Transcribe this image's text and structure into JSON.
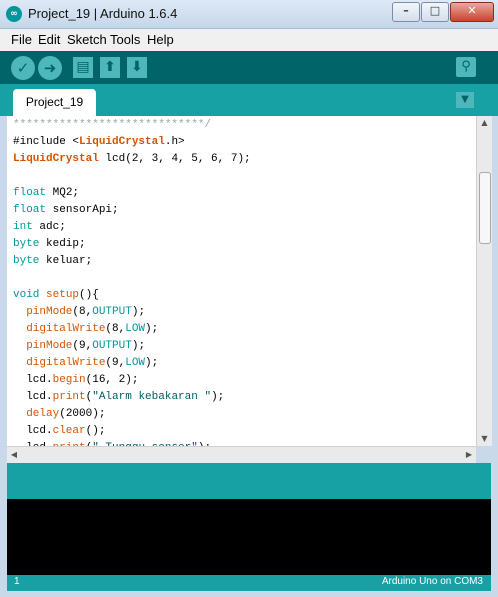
{
  "window": {
    "title": "Project_19 | Arduino 1.6.4",
    "app_icon_glyph": "∞",
    "minimize_glyph": "–",
    "maximize_glyph": "□",
    "close_glyph": "✕"
  },
  "menu": {
    "file": "File",
    "edit": "Edit",
    "sketch": "Sketch",
    "tools": "Tools",
    "help": "Help"
  },
  "toolbar": {
    "verify_icon": "check-icon",
    "upload_icon": "arrow-right-icon",
    "new_icon": "document-icon",
    "open_icon": "arrow-up-icon",
    "save_icon": "arrow-down-icon",
    "serial_monitor_icon": "magnifier-icon",
    "verify_glyph": "✓",
    "upload_glyph": "➜",
    "new_glyph": "▤",
    "open_glyph": "⬆",
    "save_glyph": "⬇",
    "serial_glyph": "⚲"
  },
  "tabs": {
    "active": "Project_19",
    "menu_glyph": "▼"
  },
  "editor": {
    "lines": [
      {
        "parts": [
          {
            "t": "*****************************/",
            "c": "comment"
          }
        ]
      },
      {
        "parts": [
          {
            "t": "#include <",
            "c": ""
          },
          {
            "t": "LiquidCrystal",
            "c": "kw-lib"
          },
          {
            "t": ".h>",
            "c": ""
          }
        ]
      },
      {
        "parts": [
          {
            "t": "LiquidCrystal",
            "c": "kw-lib"
          },
          {
            "t": " lcd(2, 3, 4, 5, 6, 7);",
            "c": ""
          }
        ]
      },
      {
        "parts": [
          {
            "t": " ",
            "c": ""
          }
        ]
      },
      {
        "parts": [
          {
            "t": "float",
            "c": "kw-type"
          },
          {
            "t": " MQ2;",
            "c": ""
          }
        ]
      },
      {
        "parts": [
          {
            "t": "float",
            "c": "kw-type"
          },
          {
            "t": " sensorApi;",
            "c": ""
          }
        ]
      },
      {
        "parts": [
          {
            "t": "int",
            "c": "kw-type"
          },
          {
            "t": " adc;",
            "c": ""
          }
        ]
      },
      {
        "parts": [
          {
            "t": "byte",
            "c": "kw-type"
          },
          {
            "t": " kedip;",
            "c": ""
          }
        ]
      },
      {
        "parts": [
          {
            "t": "byte",
            "c": "kw-type"
          },
          {
            "t": " keluar;",
            "c": ""
          }
        ]
      },
      {
        "parts": [
          {
            "t": " ",
            "c": ""
          }
        ]
      },
      {
        "parts": [
          {
            "t": "void",
            "c": "kw-type"
          },
          {
            "t": " ",
            "c": ""
          },
          {
            "t": "setup",
            "c": "kw-fn"
          },
          {
            "t": "(){",
            "c": ""
          }
        ]
      },
      {
        "parts": [
          {
            "t": "  ",
            "c": ""
          },
          {
            "t": "pinMode",
            "c": "kw-fn"
          },
          {
            "t": "(8,",
            "c": ""
          },
          {
            "t": "OUTPUT",
            "c": "kw-const"
          },
          {
            "t": ");",
            "c": ""
          }
        ]
      },
      {
        "parts": [
          {
            "t": "  ",
            "c": ""
          },
          {
            "t": "digitalWrite",
            "c": "kw-fn"
          },
          {
            "t": "(8,",
            "c": ""
          },
          {
            "t": "LOW",
            "c": "kw-const"
          },
          {
            "t": ");",
            "c": ""
          }
        ]
      },
      {
        "parts": [
          {
            "t": "  ",
            "c": ""
          },
          {
            "t": "pinMode",
            "c": "kw-fn"
          },
          {
            "t": "(9,",
            "c": ""
          },
          {
            "t": "OUTPUT",
            "c": "kw-const"
          },
          {
            "t": ");",
            "c": ""
          }
        ]
      },
      {
        "parts": [
          {
            "t": "  ",
            "c": ""
          },
          {
            "t": "digitalWrite",
            "c": "kw-fn"
          },
          {
            "t": "(9,",
            "c": ""
          },
          {
            "t": "LOW",
            "c": "kw-const"
          },
          {
            "t": ");",
            "c": ""
          }
        ]
      },
      {
        "parts": [
          {
            "t": "  lcd.",
            "c": ""
          },
          {
            "t": "begin",
            "c": "kw-fn"
          },
          {
            "t": "(16, 2);",
            "c": ""
          }
        ]
      },
      {
        "parts": [
          {
            "t": "  lcd.",
            "c": ""
          },
          {
            "t": "print",
            "c": "kw-fn"
          },
          {
            "t": "(",
            "c": ""
          },
          {
            "t": "\"Alarm kebakaran \"",
            "c": "str"
          },
          {
            "t": ");",
            "c": ""
          }
        ]
      },
      {
        "parts": [
          {
            "t": "  ",
            "c": ""
          },
          {
            "t": "delay",
            "c": "kw-fn"
          },
          {
            "t": "(2000);",
            "c": ""
          }
        ]
      },
      {
        "parts": [
          {
            "t": "  lcd.",
            "c": ""
          },
          {
            "t": "clear",
            "c": "kw-fn"
          },
          {
            "t": "();",
            "c": ""
          }
        ]
      },
      {
        "parts": [
          {
            "t": "  lcd.",
            "c": ""
          },
          {
            "t": "print",
            "c": "kw-fn"
          },
          {
            "t": "(",
            "c": ""
          },
          {
            "t": "\" Tunggu sensor\"",
            "c": "str"
          },
          {
            "t": ");",
            "c": ""
          }
        ]
      }
    ],
    "scroll_up_glyph": "▲",
    "scroll_down_glyph": "▼",
    "scroll_left_glyph": "◀",
    "scroll_right_glyph": "▶"
  },
  "status": {
    "line_number": "1",
    "board": "Arduino Uno on COM3"
  },
  "colors": {
    "toolbar": "#006468",
    "accent": "#17a1a5",
    "button": "#4db7bb",
    "keyword": "#00979c",
    "function": "#d35400"
  }
}
